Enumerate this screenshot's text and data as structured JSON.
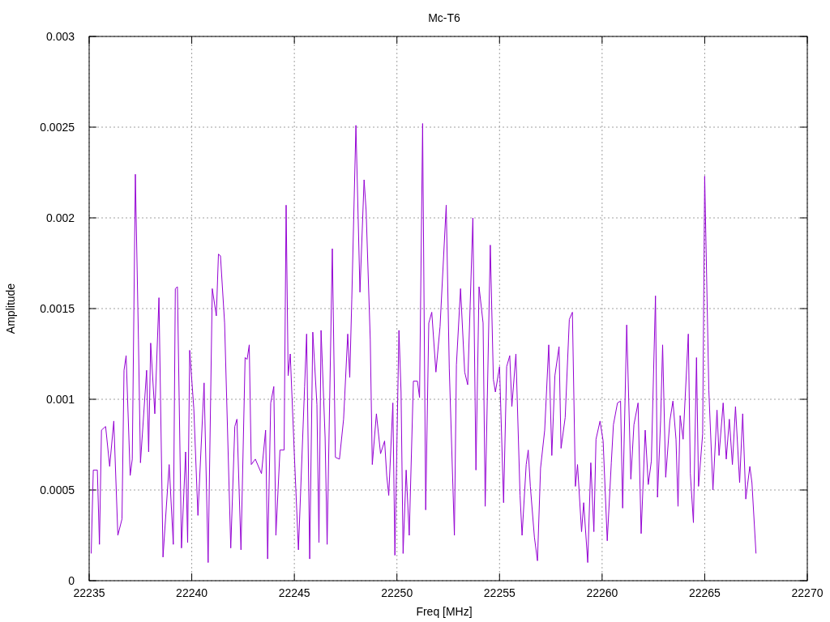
{
  "chart_data": {
    "type": "line",
    "title": "Mc-T6",
    "xlabel": "Freq [MHz]",
    "ylabel": "Amplitude",
    "xlim": [
      22235,
      22270
    ],
    "ylim": [
      0,
      0.003
    ],
    "grid": true,
    "xticks": [
      22235,
      22240,
      22245,
      22250,
      22255,
      22260,
      22265,
      22270
    ],
    "yticks": [
      0,
      0.0005,
      0.001,
      0.0015,
      0.002,
      0.0025,
      0.003
    ],
    "x": [
      22235.1,
      22235.2,
      22235.4,
      22235.5,
      22235.6,
      22235.8,
      22236.0,
      22236.2,
      22236.4,
      22236.6,
      22236.7,
      22236.8,
      22237.0,
      22237.1,
      22237.25,
      22237.4,
      22237.5,
      22237.8,
      22237.9,
      22238.0,
      22238.2,
      22238.4,
      22238.6,
      22238.9,
      22239.1,
      22239.2,
      22239.3,
      22239.5,
      22239.7,
      22239.8,
      22239.9,
      22240.1,
      22240.3,
      22240.6,
      22240.8,
      22241.0,
      22241.2,
      22241.3,
      22241.4,
      22241.6,
      22241.9,
      22242.1,
      22242.2,
      22242.4,
      22242.6,
      22242.7,
      22242.8,
      22242.9,
      22243.1,
      22243.4,
      22243.6,
      22243.7,
      22243.85,
      22244.0,
      22244.1,
      22244.3,
      22244.5,
      22244.6,
      22244.7,
      22244.8,
      22245.0,
      22245.2,
      22245.5,
      22245.6,
      22245.75,
      22245.9,
      22246.1,
      22246.2,
      22246.3,
      22246.5,
      22246.6,
      22246.85,
      22247.0,
      22247.2,
      22247.4,
      22247.6,
      22247.7,
      22247.8,
      22248.0,
      22248.2,
      22248.4,
      22248.5,
      22248.7,
      22248.8,
      22249.0,
      22249.2,
      22249.4,
      22249.5,
      22249.6,
      22249.8,
      22249.9,
      22250.1,
      22250.2,
      22250.3,
      22250.45,
      22250.6,
      22250.8,
      22251.0,
      22251.1,
      22251.25,
      22251.4,
      22251.55,
      22251.7,
      22251.9,
      22252.1,
      22252.4,
      22252.55,
      22252.8,
      22252.9,
      22253.1,
      22253.3,
      22253.45,
      22253.7,
      22253.85,
      22254.0,
      22254.2,
      22254.3,
      22254.55,
      22254.7,
      22254.8,
      22255.0,
      22255.2,
      22255.35,
      22255.5,
      22255.6,
      22255.8,
      22256.0,
      22256.1,
      22256.3,
      22256.4,
      22256.5,
      22256.7,
      22256.85,
      22257.0,
      22257.2,
      22257.4,
      22257.55,
      22257.7,
      22257.9,
      22258.0,
      22258.2,
      22258.4,
      22258.55,
      22258.7,
      22258.8,
      22259.0,
      22259.1,
      22259.3,
      22259.45,
      22259.6,
      22259.7,
      22259.9,
      22260.05,
      22260.25,
      22260.45,
      22260.55,
      22260.75,
      22260.9,
      22261.0,
      22261.2,
      22261.4,
      22261.55,
      22261.75,
      22261.9,
      22262.1,
      22262.25,
      22262.4,
      22262.6,
      22262.7,
      22262.85,
      22262.95,
      22263.1,
      22263.3,
      22263.45,
      22263.6,
      22263.7,
      22263.8,
      22263.95,
      22264.2,
      22264.3,
      22264.45,
      22264.6,
      22264.7,
      22264.9,
      22265.0,
      22265.2,
      22265.4,
      22265.6,
      22265.7,
      22265.9,
      22266.05,
      22266.2,
      22266.35,
      22266.5,
      22266.7,
      22266.85,
      22267.0,
      22267.2,
      22267.3,
      22267.5
    ],
    "series": [
      {
        "color": "#9400d3",
        "values": [
          0.00015,
          0.00061,
          0.00061,
          0.0002,
          0.00083,
          0.00085,
          0.00063,
          0.00088,
          0.00025,
          0.00034,
          0.00116,
          0.00124,
          0.00058,
          0.00067,
          0.00224,
          0.00133,
          0.00065,
          0.00116,
          0.00071,
          0.00131,
          0.00092,
          0.00156,
          0.00013,
          0.00064,
          0.0002,
          0.00161,
          0.00162,
          0.00018,
          0.00071,
          0.00021,
          0.00127,
          0.00095,
          0.00036,
          0.00109,
          0.0001,
          0.00161,
          0.00146,
          0.0018,
          0.00179,
          0.00142,
          0.00018,
          0.00085,
          0.00089,
          0.00017,
          0.00123,
          0.00122,
          0.0013,
          0.00064,
          0.00067,
          0.00059,
          0.00083,
          0.00012,
          0.00098,
          0.00107,
          0.00025,
          0.00072,
          0.00072,
          0.00207,
          0.00113,
          0.00125,
          0.0007,
          0.00017,
          0.00107,
          0.00136,
          0.00012,
          0.00137,
          0.00097,
          0.00021,
          0.00138,
          0.00079,
          0.0002,
          0.00183,
          0.00068,
          0.00067,
          0.00089,
          0.00136,
          0.00112,
          0.00155,
          0.00251,
          0.00159,
          0.00221,
          0.00204,
          0.00133,
          0.00064,
          0.00092,
          0.0007,
          0.00077,
          0.00058,
          0.00047,
          0.00098,
          0.00014,
          0.00138,
          0.00104,
          0.00015,
          0.00061,
          0.00025,
          0.0011,
          0.0011,
          0.00101,
          0.00252,
          0.00039,
          0.00142,
          0.00148,
          0.00115,
          0.0014,
          0.00207,
          0.00117,
          0.00025,
          0.00119,
          0.00161,
          0.00115,
          0.00108,
          0.002,
          0.00061,
          0.00162,
          0.00142,
          0.00041,
          0.00185,
          0.00111,
          0.00104,
          0.00118,
          0.00043,
          0.00118,
          0.00124,
          0.00096,
          0.00125,
          0.00047,
          0.00025,
          0.00064,
          0.00072,
          0.00052,
          0.00024,
          0.00011,
          0.00062,
          0.00083,
          0.0013,
          0.00069,
          0.00113,
          0.00129,
          0.00073,
          0.0009,
          0.00144,
          0.00148,
          0.00052,
          0.00064,
          0.00027,
          0.00043,
          0.0001,
          0.00065,
          0.00027,
          0.00078,
          0.00088,
          0.00077,
          0.00022,
          0.00065,
          0.00086,
          0.00098,
          0.00099,
          0.0004,
          0.00141,
          0.00056,
          0.00086,
          0.00098,
          0.00026,
          0.00083,
          0.00053,
          0.00066,
          0.00157,
          0.00046,
          0.00088,
          0.0013,
          0.00057,
          0.00088,
          0.00099,
          0.00078,
          0.00041,
          0.00091,
          0.00078,
          0.00136,
          0.00059,
          0.00032,
          0.00123,
          0.00052,
          0.00081,
          0.00223,
          0.00105,
          0.0005,
          0.00094,
          0.00069,
          0.00098,
          0.00067,
          0.00089,
          0.00064,
          0.00096,
          0.00054,
          0.00092,
          0.00045,
          0.00063,
          0.00054,
          0.00015
        ]
      }
    ]
  }
}
